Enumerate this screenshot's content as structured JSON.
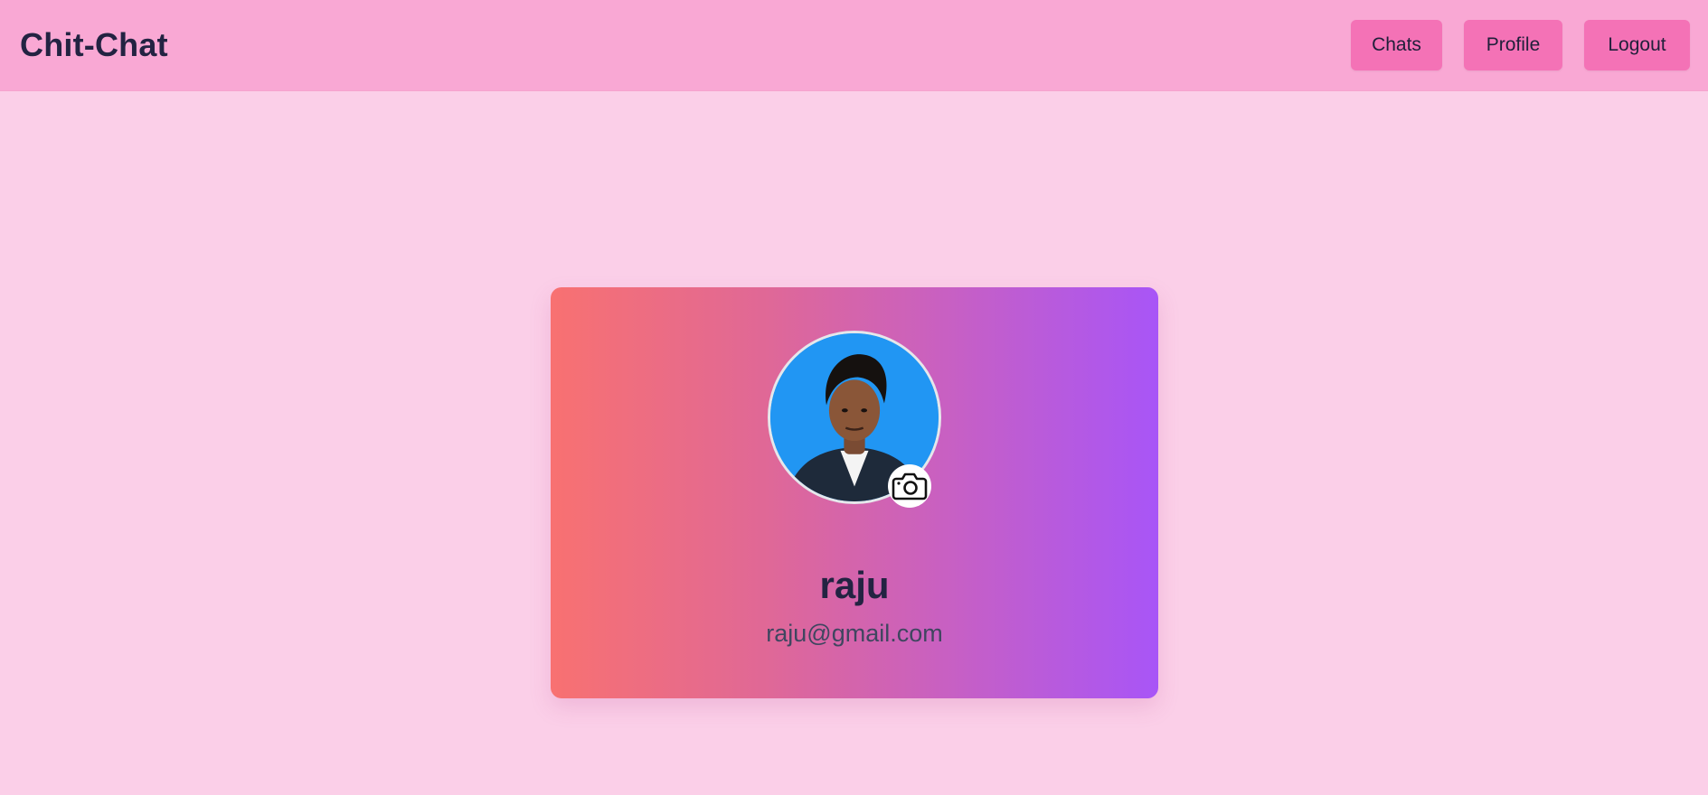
{
  "app": {
    "brand": "Chit-Chat"
  },
  "nav": {
    "chats_label": "Chats",
    "profile_label": "Profile",
    "logout_label": "Logout"
  },
  "profile": {
    "name": "raju",
    "email": "raju@gmail.com",
    "avatar_alt": "profile photo",
    "camera_icon": "camera-icon"
  },
  "colors": {
    "page_bg": "#fbcfe8",
    "navbar_bg": "#f9a8d4",
    "button_bg": "#f472b6",
    "card_gradient_start": "#f87171",
    "card_gradient_end": "#a855f7",
    "avatar_bg": "#2196f3"
  }
}
